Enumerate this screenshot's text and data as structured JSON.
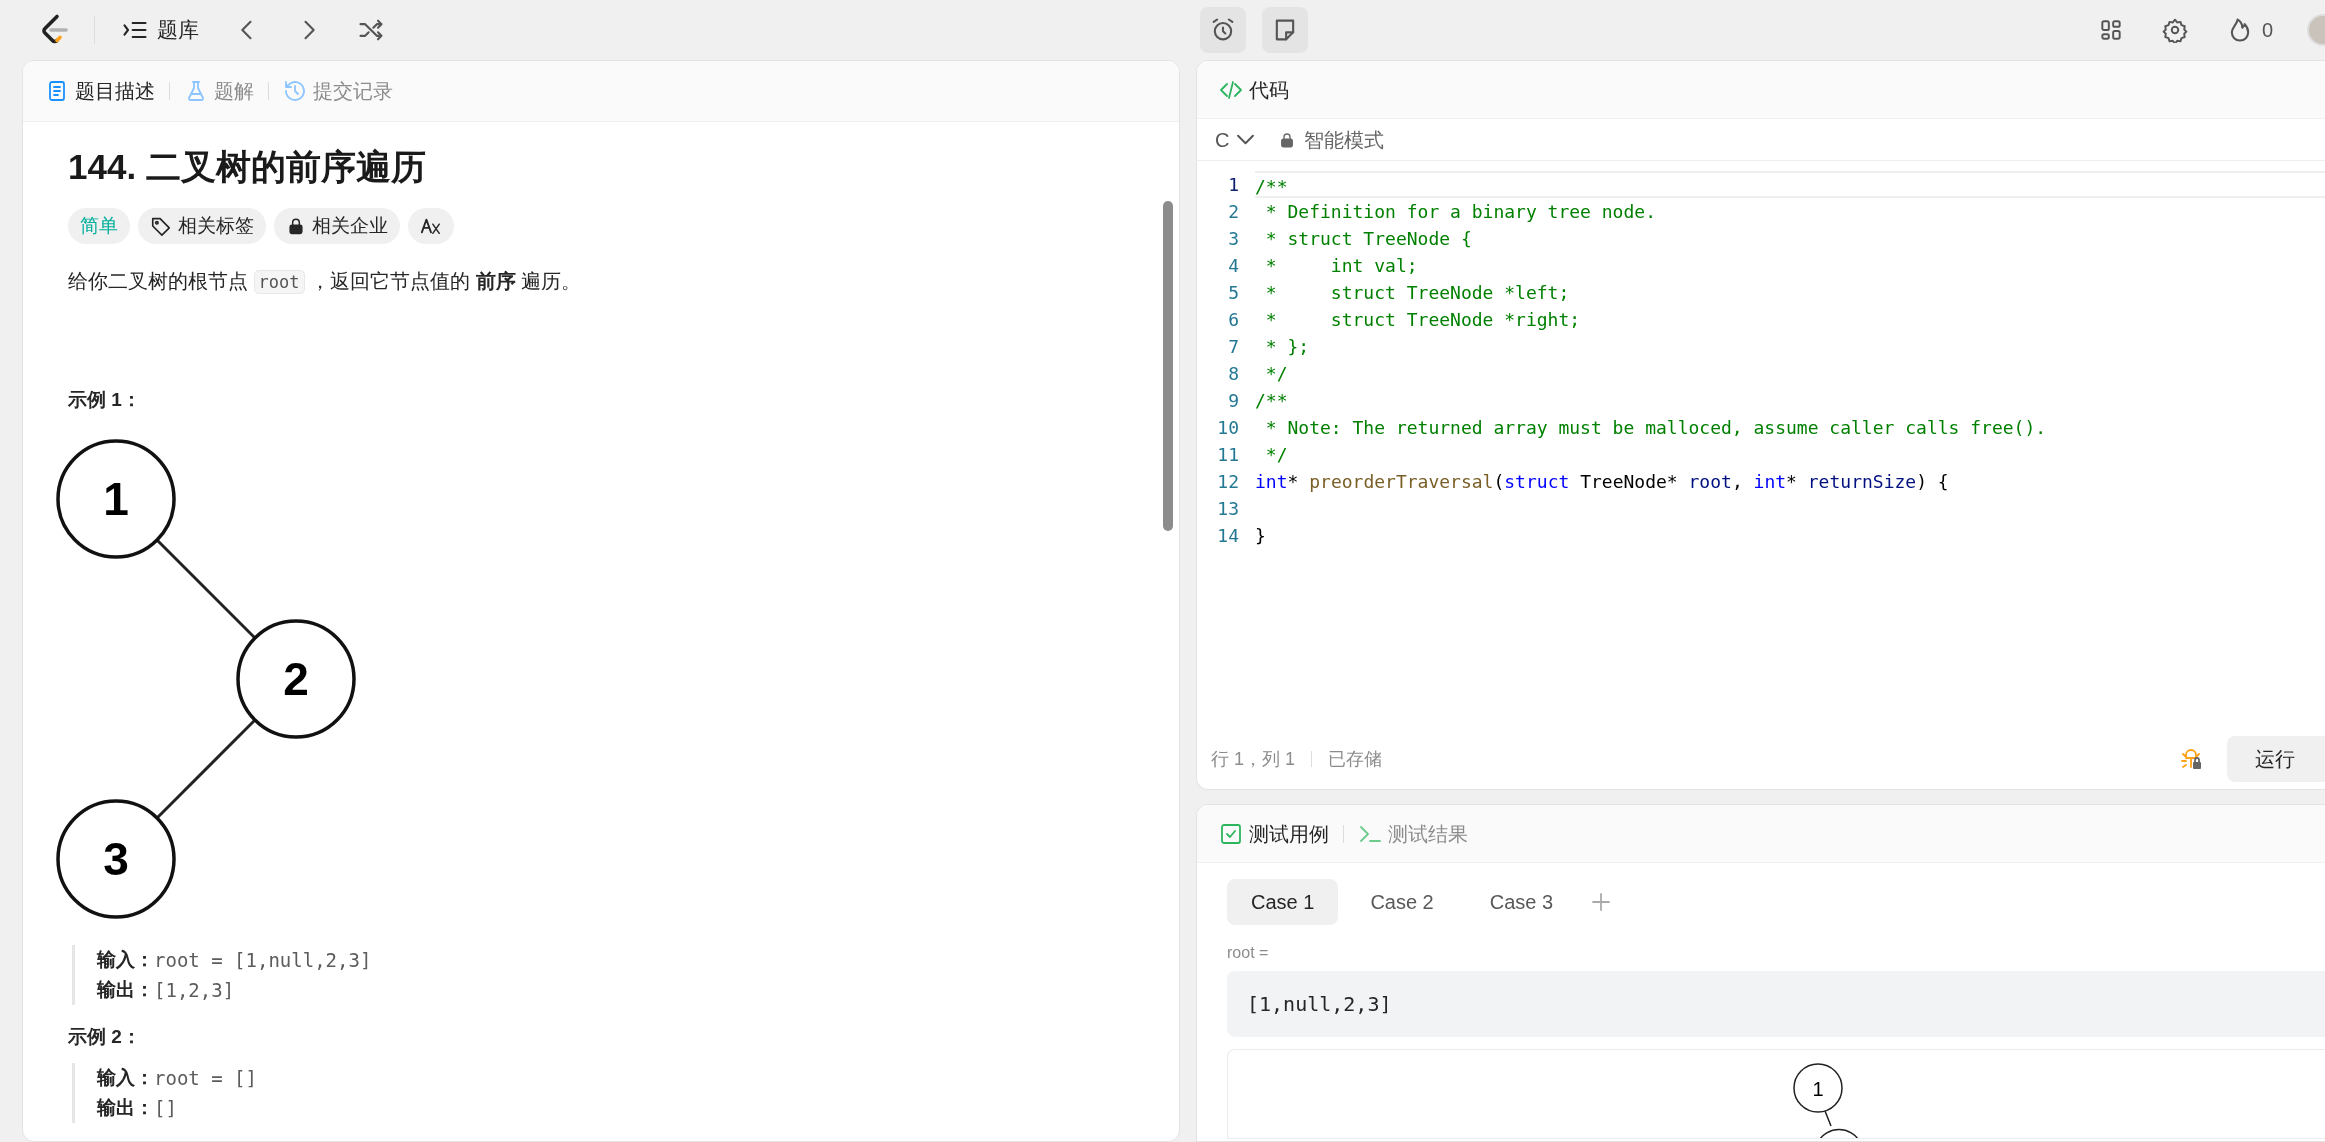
{
  "top_bar": {
    "problem_list": "题库",
    "streak": "0"
  },
  "description_panel": {
    "tabs": [
      {
        "label": "题目描述",
        "kind": "description",
        "selected": true
      },
      {
        "label": "题解",
        "kind": "solutions",
        "selected": false
      },
      {
        "label": "提交记录",
        "kind": "submissions",
        "selected": false
      }
    ],
    "title": "144. 二叉树的前序遍历",
    "tags": [
      {
        "kind": "difficulty",
        "label": "简单"
      },
      {
        "kind": "topics",
        "label": "相关标签"
      },
      {
        "kind": "companies",
        "label": "相关企业"
      }
    ],
    "description": [
      {
        "kind": "text",
        "t": "给你二叉树的根节点 "
      },
      {
        "kind": "code",
        "t": "root"
      },
      {
        "kind": "text",
        "t": " ，返回它节点值的 "
      },
      {
        "kind": "bold",
        "t": "前序"
      },
      {
        "kind": "text",
        "t": " 遍历。"
      }
    ],
    "examples": [
      {
        "heading": "示例 1：",
        "tree": {
          "label": "1",
          "right": {
            "label": "2",
            "left": {
              "label": "3"
            }
          }
        },
        "lines": [
          {
            "label": "输入：",
            "value": "root = [1,null,2,3]"
          },
          {
            "label": "输出：",
            "value": "[1,2,3]"
          }
        ]
      },
      {
        "heading": "示例 2：",
        "lines": [
          {
            "label": "输入：",
            "value": "root = []"
          },
          {
            "label": "输出：",
            "value": "[]"
          }
        ]
      }
    ]
  },
  "code_panel": {
    "title": "代码",
    "language": "C",
    "mode": "智能模式",
    "lines": [
      {
        "number": "1",
        "current": true,
        "tokens": [
          {
            "kind": "comment",
            "t": "/**"
          }
        ]
      },
      {
        "number": "2",
        "current": false,
        "tokens": [
          {
            "kind": "comment",
            "t": " * Definition for a binary tree node."
          }
        ]
      },
      {
        "number": "3",
        "current": false,
        "tokens": [
          {
            "kind": "comment",
            "t": " * struct TreeNode {"
          }
        ]
      },
      {
        "number": "4",
        "current": false,
        "tokens": [
          {
            "kind": "comment",
            "t": " *     int val;"
          }
        ]
      },
      {
        "number": "5",
        "current": false,
        "tokens": [
          {
            "kind": "comment",
            "t": " *     struct TreeNode *left;"
          }
        ]
      },
      {
        "number": "6",
        "current": false,
        "tokens": [
          {
            "kind": "comment",
            "t": " *     struct TreeNode *right;"
          }
        ]
      },
      {
        "number": "7",
        "current": false,
        "tokens": [
          {
            "kind": "comment",
            "t": " * };"
          }
        ]
      },
      {
        "number": "8",
        "current": false,
        "tokens": [
          {
            "kind": "comment",
            "t": " */"
          }
        ]
      },
      {
        "number": "9",
        "current": false,
        "tokens": [
          {
            "kind": "comment",
            "t": "/**"
          }
        ]
      },
      {
        "number": "10",
        "current": false,
        "tokens": [
          {
            "kind": "comment",
            "t": " * Note: The returned array must be malloced, assume caller calls free()."
          }
        ]
      },
      {
        "number": "11",
        "current": false,
        "tokens": [
          {
            "kind": "comment",
            "t": " */"
          }
        ]
      },
      {
        "number": "12",
        "current": false,
        "tokens": [
          {
            "kind": "keyword",
            "t": "int"
          },
          {
            "kind": "plain",
            "t": "* "
          },
          {
            "kind": "func",
            "t": "preorderTraversal"
          },
          {
            "kind": "plain",
            "t": "("
          },
          {
            "kind": "keyword",
            "t": "struct"
          },
          {
            "kind": "plain",
            "t": " TreeNode* "
          },
          {
            "kind": "param",
            "t": "root"
          },
          {
            "kind": "plain",
            "t": ", "
          },
          {
            "kind": "keyword",
            "t": "int"
          },
          {
            "kind": "plain",
            "t": "* "
          },
          {
            "kind": "param",
            "t": "returnSize"
          },
          {
            "kind": "plain",
            "t": ") {"
          }
        ]
      },
      {
        "number": "13",
        "current": false
      },
      {
        "number": "14",
        "current": false,
        "tokens": [
          {
            "kind": "plain",
            "t": "}"
          }
        ]
      }
    ],
    "status": {
      "position": "行 1，列 1",
      "saved": "已存储"
    },
    "run_button": "运行"
  },
  "test_panel": {
    "tabs": [
      {
        "label": "测试用例",
        "kind": "testcase",
        "selected": true
      },
      {
        "label": "测试结果",
        "kind": "result",
        "selected": false
      }
    ],
    "cases": [
      {
        "label": "Case 1",
        "selected": true
      },
      {
        "label": "Case 2",
        "selected": false
      },
      {
        "label": "Case 3",
        "selected": false
      }
    ],
    "param_label": "root =",
    "param_value": "[1,null,2,3]",
    "preview_root": "1"
  }
}
